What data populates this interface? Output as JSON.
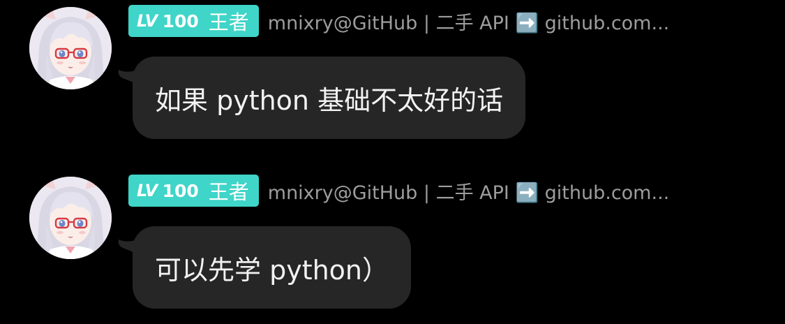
{
  "chat": {
    "messages": [
      {
        "badge": {
          "level_prefix": "LV",
          "level": "100",
          "title": "王者",
          "color": "#3fd5c8"
        },
        "sender": "mnixry@GitHub | 二手 API ➡️ github.com...",
        "avatar_icon": "anime-girl-with-glasses-avatar",
        "text": "如果 python 基础不太好的话"
      },
      {
        "badge": {
          "level_prefix": "LV",
          "level": "100",
          "title": "王者",
          "color": "#3fd5c8"
        },
        "sender": "mnixry@GitHub | 二手 API ➡️ github.com...",
        "avatar_icon": "anime-girl-with-glasses-avatar",
        "text": "可以先学 python）"
      }
    ]
  },
  "theme": {
    "background": "#000000",
    "bubble": "#262626",
    "bubble_text": "#f2f2f2",
    "sender_text": "#9d9d9d"
  }
}
